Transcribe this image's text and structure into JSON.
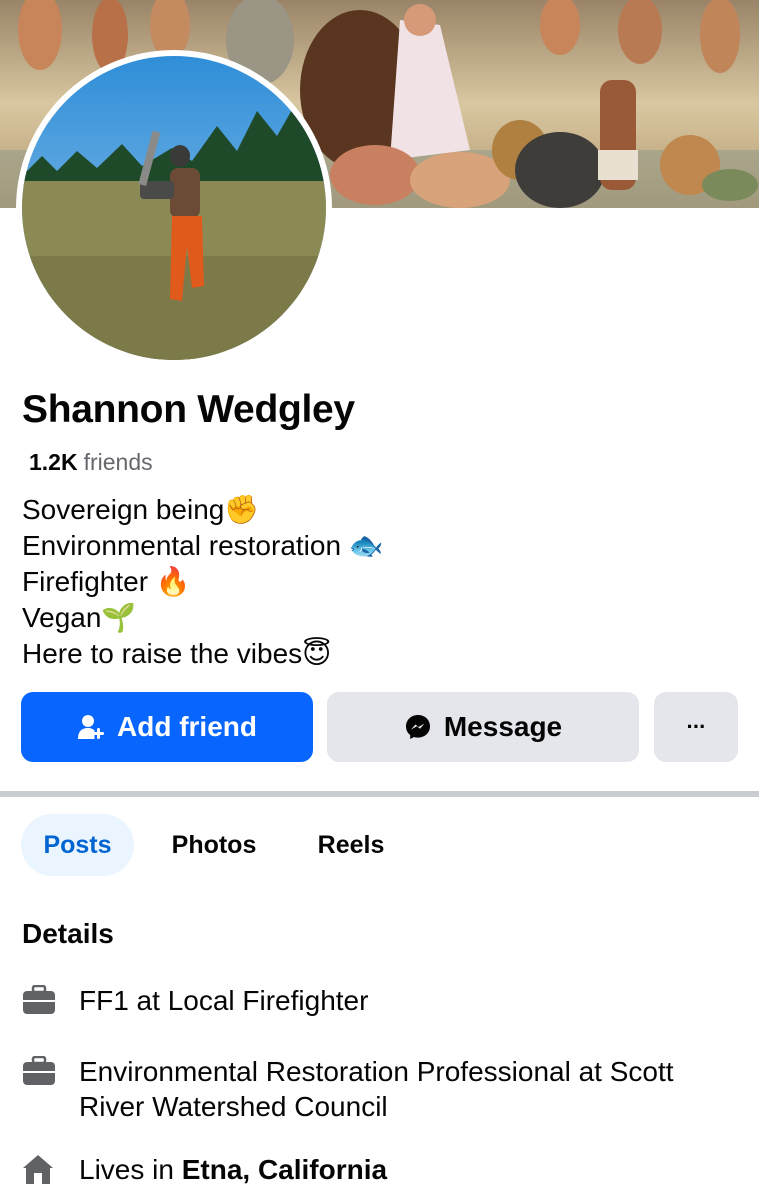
{
  "profile": {
    "name": "Shannon Wedgley",
    "friends_count": "1.2K",
    "friends_label": "friends",
    "bio": [
      {
        "text": "Sovereign being",
        "emoji": "✊"
      },
      {
        "text": "Environmental restoration ",
        "emoji": "🐟"
      },
      {
        "text": "Firefighter ",
        "emoji": "🔥"
      },
      {
        "text": "Vegan",
        "emoji": "🌱"
      },
      {
        "text": "Here to raise the vibes",
        "emoji": "😇"
      }
    ]
  },
  "actions": {
    "add_friend": "Add friend",
    "message": "Message",
    "more": "···"
  },
  "tabs": {
    "posts": "Posts",
    "photos": "Photos",
    "reels": "Reels",
    "active": "Posts"
  },
  "details": {
    "title": "Details",
    "items": [
      {
        "icon": "briefcase-icon",
        "text": "FF1 at Local Firefighter"
      },
      {
        "icon": "briefcase-icon",
        "text": "Environmental Restoration Professional at Scott River Watershed Council"
      },
      {
        "icon": "home-icon",
        "prefix": "Lives in ",
        "place": "Etna, California"
      }
    ]
  },
  "colors": {
    "primary_button": "#0866ff",
    "secondary_button": "#e4e6eb",
    "active_tab_bg": "#ebf5ff",
    "active_tab_text": "#0064d1",
    "muted_text": "#65676b"
  }
}
